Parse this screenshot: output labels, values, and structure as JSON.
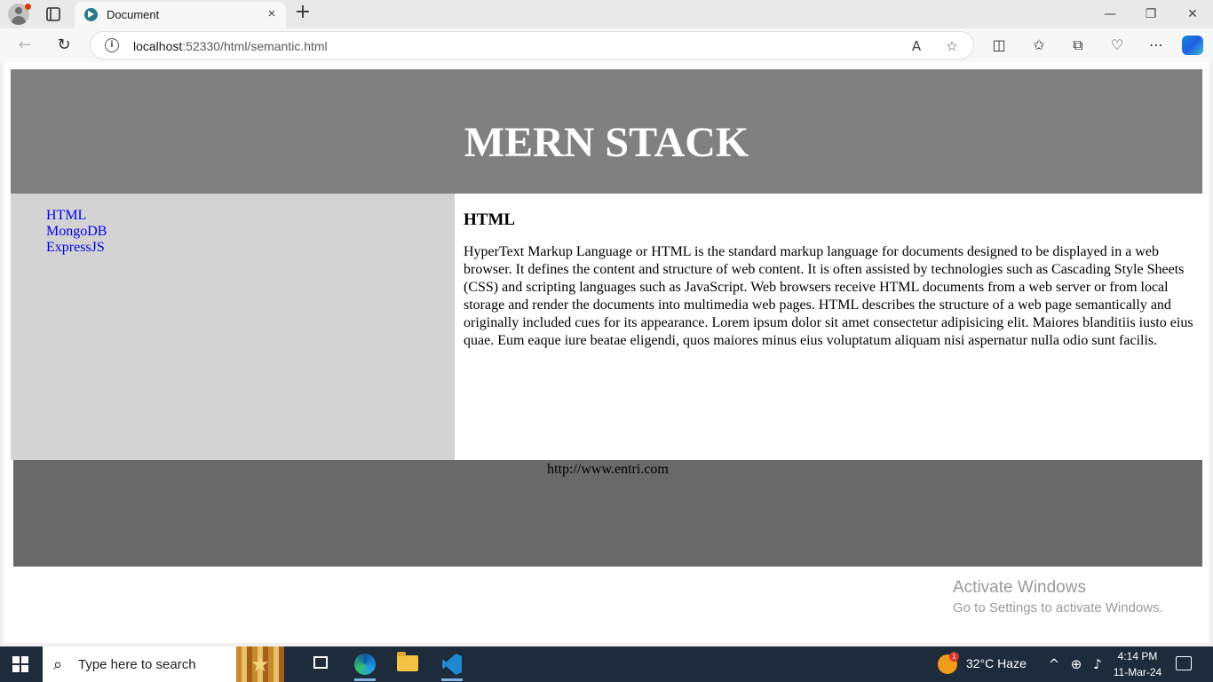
{
  "browser": {
    "tab_title": "Document",
    "tab_close_icon": "×",
    "new_tab_icon": "+",
    "window": {
      "minimize": "—",
      "restore": "❐",
      "close": "✕"
    },
    "address": {
      "host": "localhost",
      "rest": ":52330/html/semantic.html"
    },
    "nav": {
      "back": "←",
      "refresh": "↻"
    }
  },
  "page": {
    "header_title": "MERN STACK",
    "nav_links": [
      "HTML",
      "MongoDB",
      "ExpressJS"
    ],
    "article_heading": "HTML",
    "article_text": "HyperText Markup Language or HTML is the standard markup language for documents designed to be displayed in a web browser. It defines the content and structure of web content. It is often assisted by technologies such as Cascading Style Sheets (CSS) and scripting languages such as JavaScript. Web browsers receive HTML documents from a web server or from local storage and render the documents into multimedia web pages. HTML describes the structure of a web page semantically and originally included cues for its appearance. Lorem ipsum dolor sit amet consectetur adipisicing elit. Maiores blanditiis iusto eius quae. Eum eaque iure beatae eligendi, quos maiores minus eius voluptatum aliquam nisi aspernatur nulla odio sunt facilis.",
    "footer_text": "http://www.entri.com"
  },
  "watermark": {
    "line1": "Activate Windows",
    "line2": "Go to Settings to activate Windows."
  },
  "taskbar": {
    "search_placeholder": "Type here to search",
    "weather": "32°C  Haze",
    "weather_badge": "1",
    "time": "4:14 PM",
    "date": "11-Mar-24"
  },
  "colors": {
    "header_bg": "#808080",
    "sidebar_bg": "#d3d3d3",
    "footer_bg": "#696969",
    "link": "#0000ee",
    "taskbar_bg": "#1d2b3a"
  }
}
